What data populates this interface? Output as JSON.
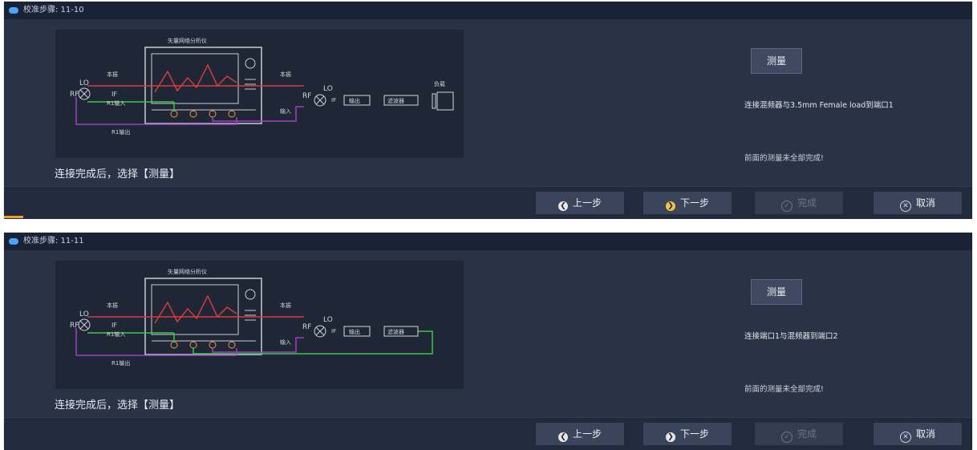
{
  "panels": [
    {
      "title": "校准步骤: 11-10",
      "diagram": {
        "analyzer_label": "矢量网络分析仪",
        "lo_left": "LO",
        "rf_left": "RF",
        "if_label": "IF",
        "benzhen_left": "本振",
        "r1_in": "R1输入",
        "r1_out": "R1输出",
        "benzhen_right": "本振",
        "input_label": "输入",
        "rf_right": "RF",
        "lo_right": "LO",
        "if_right": "IF",
        "out_box": "输出",
        "filter_box": "滤波器",
        "load_label": "负载"
      },
      "instruction": "连接完成后，选择【测量】",
      "measure_button": "测量",
      "step_info": "连接混频器与3.5mm Female load到端口1",
      "status_text": "前面的测量未全部完成!",
      "buttons": {
        "prev": "上一步",
        "next": "下一步",
        "done": "完成",
        "cancel": "取消"
      }
    },
    {
      "title": "校准步骤: 11-11",
      "diagram": {
        "analyzer_label": "矢量网络分析仪",
        "lo_left": "LO",
        "rf_left": "RF",
        "if_label": "IF",
        "benzhen_left": "本振",
        "r1_in": "R1输入",
        "r1_out": "R1输出",
        "benzhen_right": "本振",
        "input_label": "输入",
        "rf_right": "RF",
        "lo_right": "LO",
        "if_right": "IF",
        "out_box": "输出",
        "filter_box": "滤波器"
      },
      "instruction": "连接完成后，选择【测量】",
      "measure_button": "测量",
      "step_info": "连接端口1与混频器到端口2",
      "status_text": "前面的测量未全部完成!",
      "buttons": {
        "prev": "上一步",
        "next": "下一步",
        "done": "完成",
        "cancel": "取消"
      }
    }
  ],
  "colors": {
    "panel_bg": "#2a3346",
    "titlebar_bg": "#1a2236",
    "lo_line": "#d63c3c",
    "if_line": "#3cc84a",
    "r1_line": "#a040c0",
    "next_icon": "#f0c24a"
  },
  "icons": [
    "app-icon",
    "prev-icon",
    "next-icon",
    "done-icon",
    "cancel-icon"
  ]
}
